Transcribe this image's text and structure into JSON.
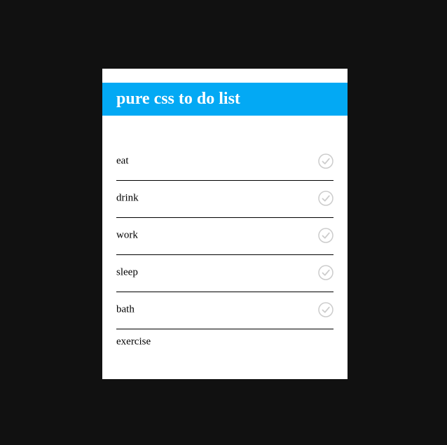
{
  "header": {
    "title": "pure css to do list"
  },
  "todo": {
    "items": [
      {
        "label": "eat",
        "icon": "check-circle-icon"
      },
      {
        "label": "drink",
        "icon": "check-circle-icon"
      },
      {
        "label": "work",
        "icon": "check-circle-icon"
      },
      {
        "label": "sleep",
        "icon": "check-circle-icon"
      },
      {
        "label": "bath",
        "icon": "check-circle-icon"
      },
      {
        "label": "exercise"
      }
    ]
  },
  "colors": {
    "page_background": "#111111",
    "card_background": "#ffffff",
    "header_accent": "#03a9f4",
    "check_icon": "#cccccc"
  }
}
